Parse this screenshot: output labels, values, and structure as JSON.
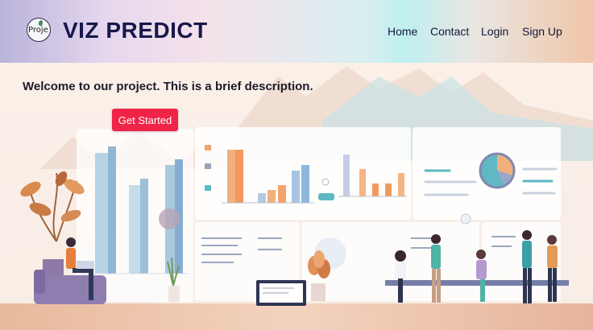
{
  "brand": {
    "logo_text": "Proje",
    "name": "VIZ PREDICT"
  },
  "nav": {
    "items": [
      "Home",
      "Contact",
      "Login",
      "Sign Up"
    ]
  },
  "hero": {
    "description": "Welcome to our project. This is a brief description.",
    "cta_label": "Get Started"
  },
  "colors": {
    "accent": "#f02448",
    "brand_text": "#16184a"
  }
}
